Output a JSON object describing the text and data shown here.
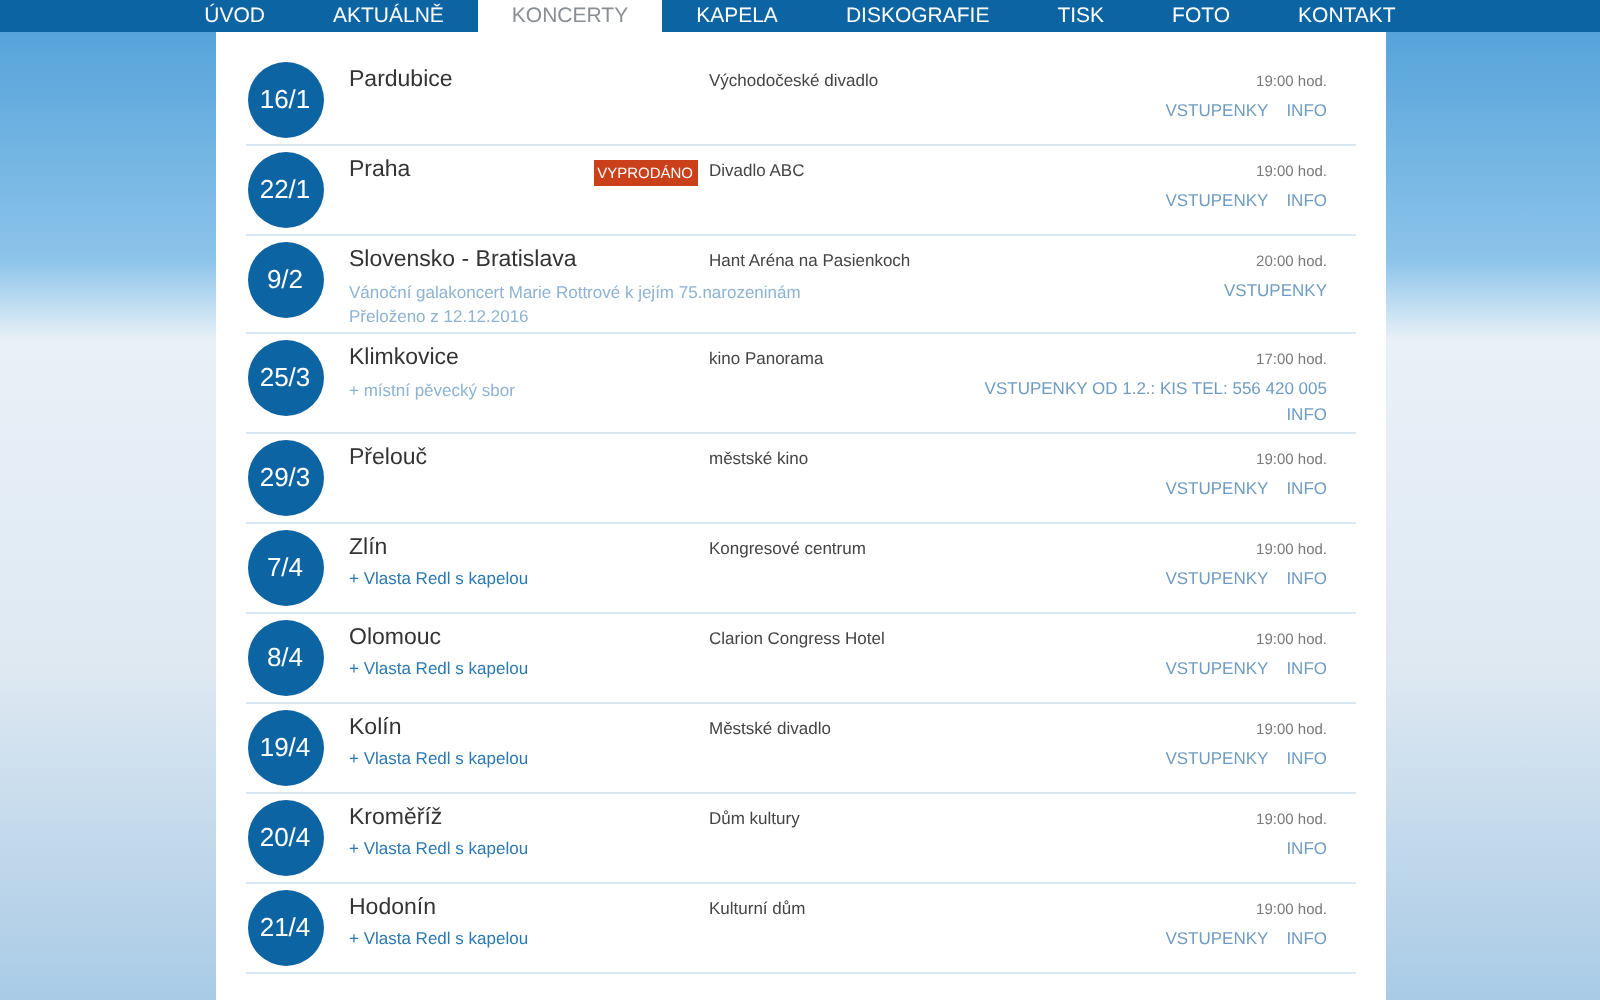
{
  "nav": [
    {
      "label": "ÚVOD",
      "selected": false
    },
    {
      "label": "AKTUÁLNĚ",
      "selected": false
    },
    {
      "label": "KONCERTY",
      "selected": true
    },
    {
      "label": "KAPELA",
      "selected": false
    },
    {
      "label": "DISKOGRAFIE",
      "selected": false
    },
    {
      "label": "TISK",
      "selected": false
    },
    {
      "label": "FOTO",
      "selected": false
    },
    {
      "label": "KONTAKT",
      "selected": false
    }
  ],
  "concerts": [
    {
      "date": "16/1",
      "city": "Pardubice",
      "venue": "Východočeské divadlo",
      "time": "19:00 hod.",
      "links": [
        "VSTUPENKY",
        "INFO"
      ]
    },
    {
      "date": "22/1",
      "city": "Praha",
      "badge": "VYPRODÁNO",
      "venue": "Divadlo ABC",
      "time": "19:00 hod.",
      "links": [
        "VSTUPENKY",
        "INFO"
      ]
    },
    {
      "date": "9/2",
      "city": "Slovensko - Bratislava",
      "notes": [
        {
          "kind": "note",
          "text": "Vánoční galakoncert Marie Rottrové k jejím 75.narozeninám"
        },
        {
          "kind": "note",
          "text": "Přeloženo z 12.12.2016"
        }
      ],
      "venue": "Hant Aréna na Pasienkoch",
      "time": "20:00 hod.",
      "links": [
        "VSTUPENKY"
      ]
    },
    {
      "date": "25/3",
      "city": "Klimkovice",
      "notes": [
        {
          "kind": "note",
          "text": "+ místní pěvecký sbor"
        }
      ],
      "venue": "kino Panorama",
      "time": "17:00 hod.",
      "links": [
        "VSTUPENKY OD 1.2.: KIS TEL: 556 420 005",
        "INFO"
      ],
      "stacked": true
    },
    {
      "date": "29/3",
      "city": "Přelouč",
      "venue": "městské kino",
      "time": "19:00 hod.",
      "links": [
        "VSTUPENKY",
        "INFO"
      ]
    },
    {
      "date": "7/4",
      "city": "Zlín",
      "notes": [
        {
          "kind": "guest",
          "text": "+ Vlasta Redl s kapelou"
        }
      ],
      "venue": "Kongresové centrum",
      "time": "19:00 hod.",
      "links": [
        "VSTUPENKY",
        "INFO"
      ]
    },
    {
      "date": "8/4",
      "city": "Olomouc",
      "notes": [
        {
          "kind": "guest",
          "text": "+ Vlasta Redl s kapelou"
        }
      ],
      "venue": "Clarion Congress Hotel",
      "time": "19:00 hod.",
      "links": [
        "VSTUPENKY",
        "INFO"
      ]
    },
    {
      "date": "19/4",
      "city": "Kolín",
      "notes": [
        {
          "kind": "guest",
          "text": "+ Vlasta Redl s kapelou"
        }
      ],
      "venue": "Městské divadlo",
      "time": "19:00 hod.",
      "links": [
        "VSTUPENKY",
        "INFO"
      ]
    },
    {
      "date": "20/4",
      "city": "Kroměříž",
      "notes": [
        {
          "kind": "guest",
          "text": "+ Vlasta Redl s kapelou"
        }
      ],
      "venue": "Dům kultury",
      "time": "19:00 hod.",
      "links": [
        "INFO"
      ]
    },
    {
      "date": "21/4",
      "city": "Hodonín",
      "notes": [
        {
          "kind": "guest",
          "text": "+ Vlasta Redl s kapelou"
        }
      ],
      "venue": "Kulturní dům",
      "time": "19:00 hod.",
      "links": [
        "VSTUPENKY",
        "INFO"
      ]
    }
  ]
}
